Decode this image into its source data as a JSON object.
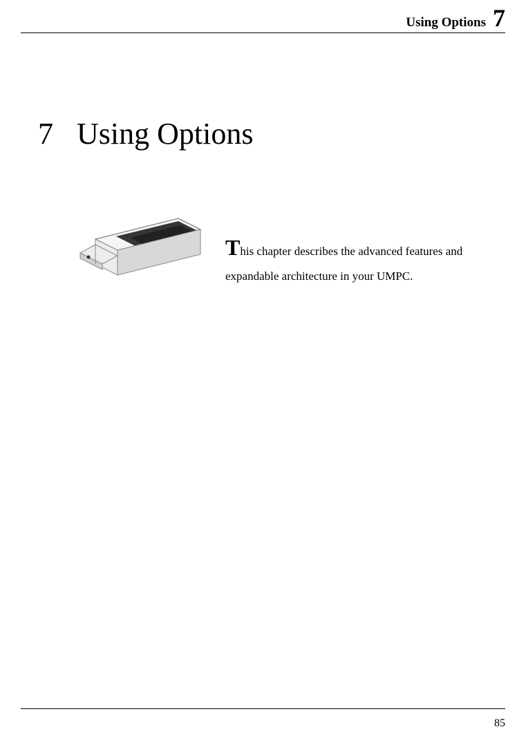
{
  "header": {
    "title": "Using Options",
    "chapter_number": "7"
  },
  "chapter": {
    "number": "7",
    "title": "Using Options"
  },
  "intro": {
    "drop_cap": "T",
    "text": "his chapter describes the advanced features and expandable architecture in your UMPC."
  },
  "footer": {
    "page_number": "85"
  }
}
